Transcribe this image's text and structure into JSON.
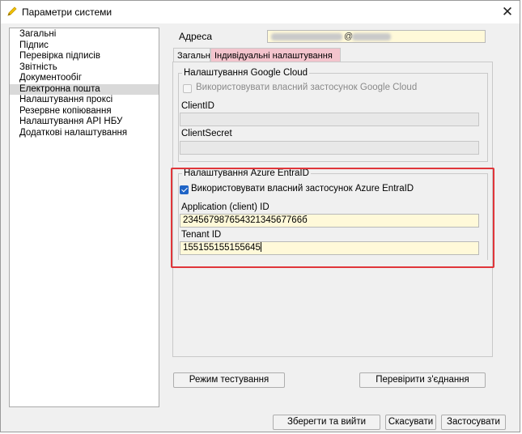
{
  "window": {
    "title": "Параметри системи",
    "close_glyph": "✕",
    "accent_color": "#e0363a",
    "app_icon": "pen-icon"
  },
  "sidebar": {
    "items": [
      {
        "label": "Загальні"
      },
      {
        "label": "Підпис"
      },
      {
        "label": "Перевірка підписів"
      },
      {
        "label": "Звітність"
      },
      {
        "label": "Документообіг"
      },
      {
        "label": "Електронна пошта",
        "selected": true
      },
      {
        "label": "Налаштування проксі"
      },
      {
        "label": "Резервне копіювання"
      },
      {
        "label": "Налаштування API НБУ"
      },
      {
        "label": "Додаткові налаштування"
      }
    ]
  },
  "address": {
    "label": "Адреса",
    "at_sign": "@"
  },
  "tabs": [
    {
      "label": "Загальні"
    },
    {
      "label": "Індивідуальні налаштування пошти",
      "selected": true
    }
  ],
  "google": {
    "group_title": "Налаштування Google Cloud",
    "checkbox_label": "Використовувати власний застосунок Google Cloud",
    "checkbox_checked": false,
    "client_id_label": "ClientID",
    "client_id_value": "",
    "client_secret_label": "ClientSecret",
    "client_secret_value": ""
  },
  "azure": {
    "group_title": "Налаштування Azure EntraID",
    "checkbox_label": "Використовувати власний застосунок Azure EntraID",
    "checkbox_checked": true,
    "app_id_label": "Application (client) ID",
    "app_id_value": "23456798765432134567766б",
    "tenant_id_label": "Tenant ID",
    "tenant_id_value": "155155155155645"
  },
  "buttons": {
    "test_mode": "Режим тестування",
    "check_connection": "Перевірити з'єднання",
    "save_exit": "Зберегти та вийти",
    "cancel": "Скасувати",
    "apply": "Застосувати"
  }
}
